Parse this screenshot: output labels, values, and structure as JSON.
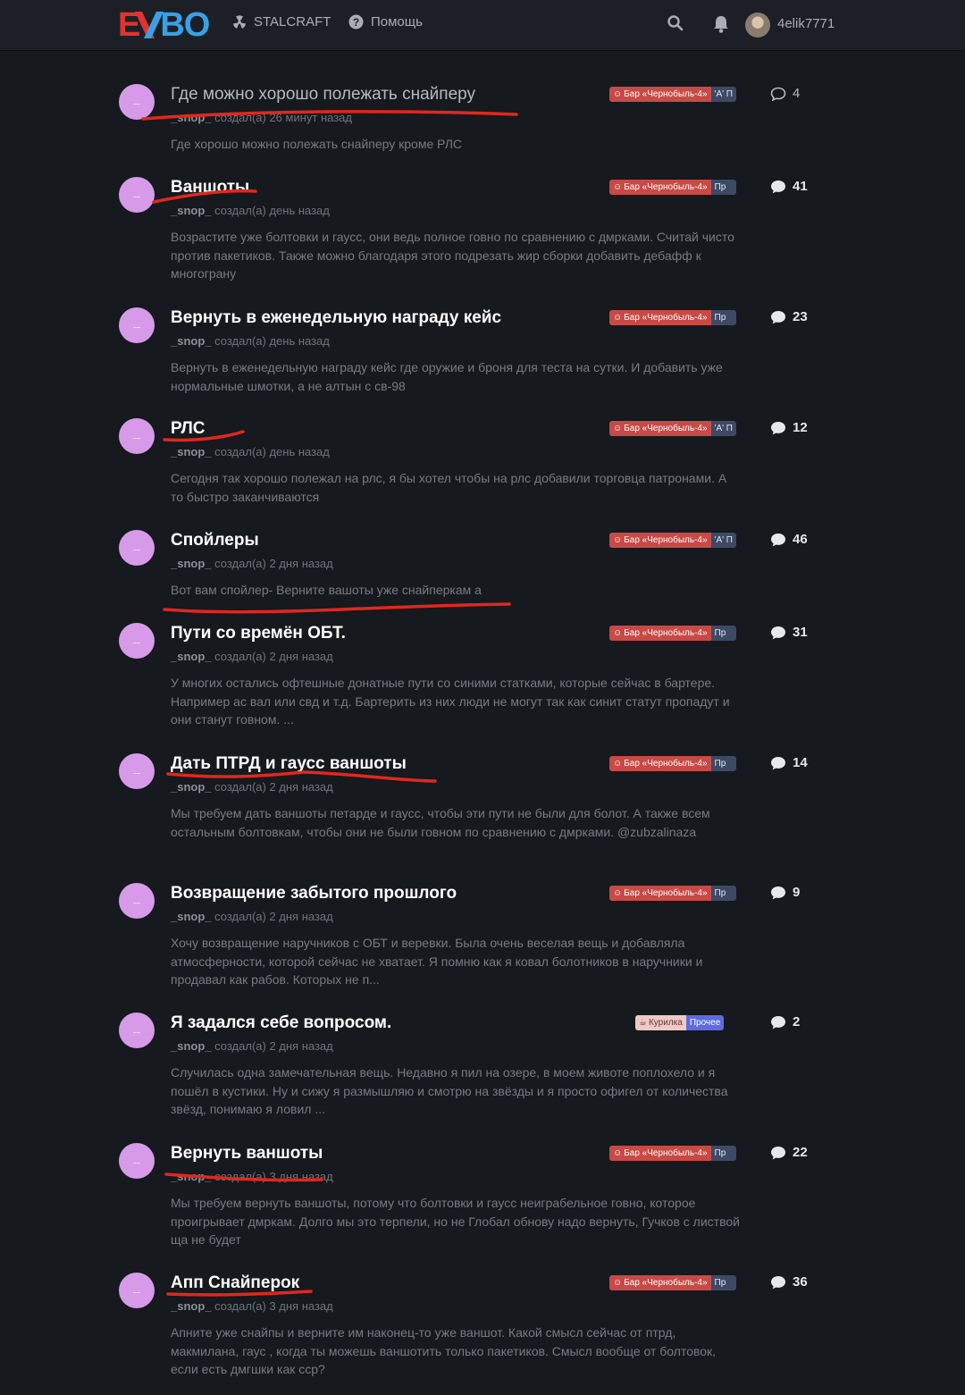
{
  "header": {
    "nav_stalcraft": "STALCRAFT",
    "nav_help": "Помощь",
    "username": "4elik7771"
  },
  "topics": [
    {
      "title": "Где можно хорошо полежать снайперу",
      "author": "_snop_",
      "meta": "создал(а) 26 минут назад",
      "excerpt": "Где хорошо можно полежать снайперу кроме РЛС",
      "tag1": "Бар «Чернобыль-4»",
      "tag2": "'А' П",
      "replies": "4"
    },
    {
      "title": "Ваншоты",
      "author": "_snop_",
      "meta": "создал(а) день назад",
      "excerpt": "Возрастите уже болтовки и гаусс, они ведь полное говно по сравнению с дмрками. Считай чисто против пакетиков. Также можно благодаря этого подрезать жир сборки добавить дебафф к многограну",
      "tag1": "Бар «Чернобыль-4»",
      "tag2": "Пр",
      "replies": "41"
    },
    {
      "title": "Вернуть в еженедельную награду кейс",
      "author": "_snop_",
      "meta": "создал(а) день назад",
      "excerpt": "Вернуть в еженедельную награду кейс где оружие и броня для теста на сутки. И добавить уже нормальные шмотки, а не алтын с св-98",
      "tag1": "Бар «Чернобыль-4»",
      "tag2": "Пр",
      "replies": "23"
    },
    {
      "title": "РЛС",
      "author": "_snop_",
      "meta": "создал(а) день назад",
      "excerpt": "Сегодня так хорошо полежал на рлс, я бы хотел чтобы на рлс добавили торговца патронами. А то быстро заканчиваются",
      "tag1": "Бар «Чернобыль-4»",
      "tag2": "'А' П",
      "replies": "12"
    },
    {
      "title": "Спойлеры",
      "author": "_snop_",
      "meta": "создал(а) 2 дня назад",
      "excerpt": "Вот вам спойлер- Верните вашоты уже снайперкам а",
      "tag1": "Бар «Чернобыль-4»",
      "tag2": "'А' П",
      "replies": "46"
    },
    {
      "title": "Пути со времён ОБТ.",
      "author": "_snop_",
      "meta": "создал(а) 2 дня назад",
      "excerpt": "У многих остались офтешные донатные пути со синими статками, которые сейчас в бартере. Например ас вал или свд и т.д. Бартерить из них люди не могут так как синит статут пропадут и они станут говном. ...",
      "tag1": "Бар «Чернобыль-4»",
      "tag2": "Пр",
      "replies": "31"
    },
    {
      "title": "Дать ПТРД и гаусс ваншоты",
      "author": "_snop_",
      "meta": "создал(а) 2 дня назад",
      "excerpt": "Мы требуем дать ваншоты петарде и гаусс, чтобы эти пути не были для болот. А также всем остальным болтовкам, чтобы они не были говном по сравнению с дмрками. @zubzalinaza",
      "tag1": "Бар «Чернобыль-4»",
      "tag2": "Пр",
      "replies": "14"
    },
    {
      "title": "Возвращение забытого прошлого",
      "author": "_snop_",
      "meta": "создал(а) 2 дня назад",
      "excerpt": "Хочу возвращение наручников с ОБТ и веревки. Была очень веселая вещь и добавляла атмосферности, которой сейчас не хватает. Я помню как я ковал болотников в наручники и продавал как рабов. Которых не п...",
      "tag1": "Бар «Чернобыль-4»",
      "tag2": "Пр",
      "replies": "9"
    },
    {
      "title": "Я задался себе вопросом.",
      "author": "_snop_",
      "meta": "создал(а) 2 дня назад",
      "excerpt": "Случилась одна замечательная вещь. Недавно я пил на озере, в моем животе поплохело и я пошёл в кустики. Ну и сижу я размышляю и смотрю на звёзды и я просто офигел от количества звёзд, понимаю я ловил ...",
      "tag1": "Курилка",
      "tag2": "Прочее",
      "replies": "2"
    },
    {
      "title": "Вернуть ваншоты",
      "author": "_snop_",
      "meta": "создал(а) 3 дня назад",
      "excerpt": "Мы требуем вернуть ваншоты, потому что болтовки и гаусс неиграбельное говно, которое проигрывает дмркам. Долго мы это терпели, но не Глобал обнову надо вернуть, Гучков с листвой ща не будет",
      "tag1": "Бар «Чернобыль-4»",
      "tag2": "Пр",
      "replies": "22"
    },
    {
      "title": "Апп Снайперок",
      "author": "_snop_",
      "meta": "создал(а) 3 дня назад",
      "excerpt": "Апните уже снайпы и верните им наконец-то уже ваншот. Какой смысл сейчас от птрд, макмилана, гаус , когда ты можешь ваншотить только пакетиков. Смысл вообще от болтовок, если есть дмгшки как сср?",
      "tag1": "Бар «Чернобыль-4»",
      "tag2": "Пр",
      "replies": "36"
    }
  ],
  "colors": {
    "background": "#16191e",
    "avatar": "#d79ae8",
    "tag_red": "#c74a46",
    "tag_grey": "#3d4a66",
    "annotation": "#e0281e"
  }
}
